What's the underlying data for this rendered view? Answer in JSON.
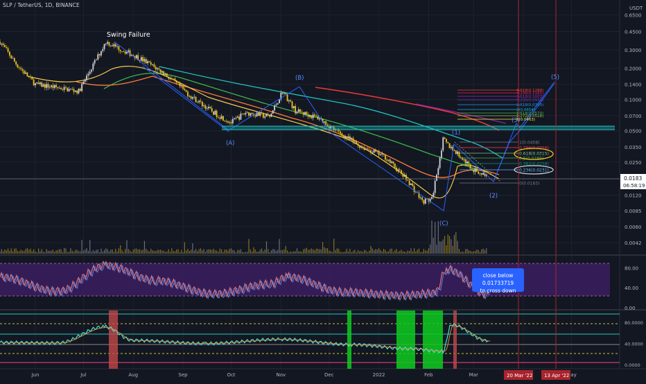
{
  "header": {
    "symbol_line": "SLP / TetherUS, 1D, BINANCE"
  },
  "price_axis": {
    "unit": "USDT",
    "labels": [
      "0.6500",
      "0.4500",
      "0.3000",
      "0.2000",
      "0.1400",
      "0.1000",
      "0.0700",
      "0.0500",
      "0.0350",
      "0.0250",
      "0.0120",
      "0.0085",
      "0.0060",
      "0.0042"
    ],
    "last_price": "0.0183",
    "countdown": "06:58:19"
  },
  "time_axis": {
    "labels": [
      "Jun",
      "Jul",
      "Aug",
      "Sep",
      "Oct",
      "Nov",
      "Dec",
      "2022",
      "Feb",
      "Mar",
      "Apr",
      "May"
    ],
    "marker_labels": [
      "20 Mar '22",
      "13 Apr '22"
    ]
  },
  "annotations": {
    "swing_failure": "Swing Failure",
    "waves": [
      "(A)",
      "(B)",
      "(C)",
      "(1)",
      "(2)",
      "(3)",
      "(5)"
    ],
    "callout": [
      "close below 0.01733719",
      "to cross down"
    ]
  },
  "fib_labels": [
    {
      "text": "1(0.0408)",
      "y": 205
    },
    {
      "text": "0.786(0.0356)",
      "y": 213
    },
    {
      "text": "0.618(0.0315)",
      "y": 221
    },
    {
      "text": "0.5(0.0289)",
      "y": 228
    },
    {
      "text": "0.382(0.0258)",
      "y": 236
    },
    {
      "text": "0.236(0.0231)",
      "y": 245
    },
    {
      "text": "0(0.0165)",
      "y": 264
    }
  ],
  "fib_ext_labels": [
    {
      "text": "4.618(0.1288)",
      "y": 130,
      "color": "#f44336"
    },
    {
      "text": "4.236(0.1181)",
      "y": 134,
      "color": "#e91e63"
    },
    {
      "text": "3.618(0.1003)",
      "y": 139,
      "color": "#9c27b0"
    },
    {
      "text": "3.236(0.0931)",
      "y": 144,
      "color": "#673ab7"
    },
    {
      "text": "2.618(0.0790)",
      "y": 151,
      "color": "#2196f3"
    },
    {
      "text": "2(0.0654)",
      "y": 158,
      "color": "#00bcd4"
    },
    {
      "text": "1.618(0.0579)",
      "y": 163,
      "color": "#4caf50"
    },
    {
      "text": "1.272(0.0518)",
      "y": 167,
      "color": "#8bc34a"
    },
    {
      "text": "1(0.0463)",
      "y": 172,
      "color": "#ffeb3b"
    }
  ],
  "rsi_axis": {
    "labels": [
      "80.00",
      "40.00",
      "0.00"
    ]
  },
  "osc_axis": {
    "labels": [
      "80.0000",
      "40.0000",
      "0.0000"
    ]
  },
  "colors": {
    "background": "#131722",
    "up": "#d1d4dc",
    "down": "#f0c419",
    "rsi_band": "#3b1f5f",
    "green_zone": "#0ecb1f",
    "red_zone": "#c2484a",
    "marker_line": "#a8242c",
    "accent": "#2962ff"
  },
  "chart_data": [
    {
      "type": "candlestick",
      "title": "SLP / TetherUS, 1D, BINANCE",
      "y_scale": "log",
      "ylim": [
        0.0035,
        0.8
      ],
      "x_range": [
        "2021-05-10",
        "2022-05-31"
      ],
      "close_series": [
        {
          "date": "2021-05-10",
          "close": 0.36
        },
        {
          "date": "2021-05-20",
          "close": 0.22
        },
        {
          "date": "2021-06-01",
          "close": 0.14
        },
        {
          "date": "2021-06-15",
          "close": 0.13
        },
        {
          "date": "2021-06-28",
          "close": 0.12
        },
        {
          "date": "2021-07-10",
          "close": 0.26
        },
        {
          "date": "2021-07-15",
          "close": 0.36
        },
        {
          "date": "2021-07-25",
          "close": 0.3
        },
        {
          "date": "2021-08-05",
          "close": 0.25
        },
        {
          "date": "2021-08-20",
          "close": 0.18
        },
        {
          "date": "2021-09-05",
          "close": 0.11
        },
        {
          "date": "2021-09-20",
          "close": 0.075
        },
        {
          "date": "2021-10-01",
          "close": 0.06
        },
        {
          "date": "2021-10-10",
          "close": 0.075
        },
        {
          "date": "2021-10-25",
          "close": 0.068
        },
        {
          "date": "2021-11-02",
          "close": 0.12
        },
        {
          "date": "2021-11-10",
          "close": 0.078
        },
        {
          "date": "2021-11-25",
          "close": 0.066
        },
        {
          "date": "2021-12-05",
          "close": 0.05
        },
        {
          "date": "2021-12-20",
          "close": 0.036
        },
        {
          "date": "2022-01-05",
          "close": 0.028
        },
        {
          "date": "2022-01-20",
          "close": 0.016
        },
        {
          "date": "2022-01-28",
          "close": 0.0105
        },
        {
          "date": "2022-02-03",
          "close": 0.011
        },
        {
          "date": "2022-02-10",
          "close": 0.0408
        },
        {
          "date": "2022-02-20",
          "close": 0.029
        },
        {
          "date": "2022-03-01",
          "close": 0.021
        },
        {
          "date": "2022-03-10",
          "close": 0.0183
        }
      ]
    },
    {
      "type": "line",
      "title": "RSI",
      "ylim": [
        0,
        100
      ],
      "x": [
        "2021-05-10",
        "2021-06-15",
        "2021-07-15",
        "2021-08-15",
        "2021-09-20",
        "2021-10-25",
        "2021-11-05",
        "2021-12-10",
        "2022-01-15",
        "2022-02-05",
        "2022-02-12",
        "2022-03-10"
      ],
      "values": [
        62,
        33,
        85,
        55,
        28,
        48,
        62,
        32,
        25,
        30,
        78,
        27
      ]
    },
    {
      "type": "line",
      "title": "Oscillator",
      "ylim": [
        0,
        100
      ],
      "x": [
        "2021-05-10",
        "2021-06-15",
        "2021-07-14",
        "2021-08-01",
        "2021-09-15",
        "2021-11-01",
        "2021-12-15",
        "2022-01-20",
        "2022-02-10",
        "2022-02-15",
        "2022-03-10"
      ],
      "values": [
        42,
        41,
        72,
        46,
        40,
        48,
        38,
        30,
        25,
        76,
        45
      ]
    }
  ]
}
